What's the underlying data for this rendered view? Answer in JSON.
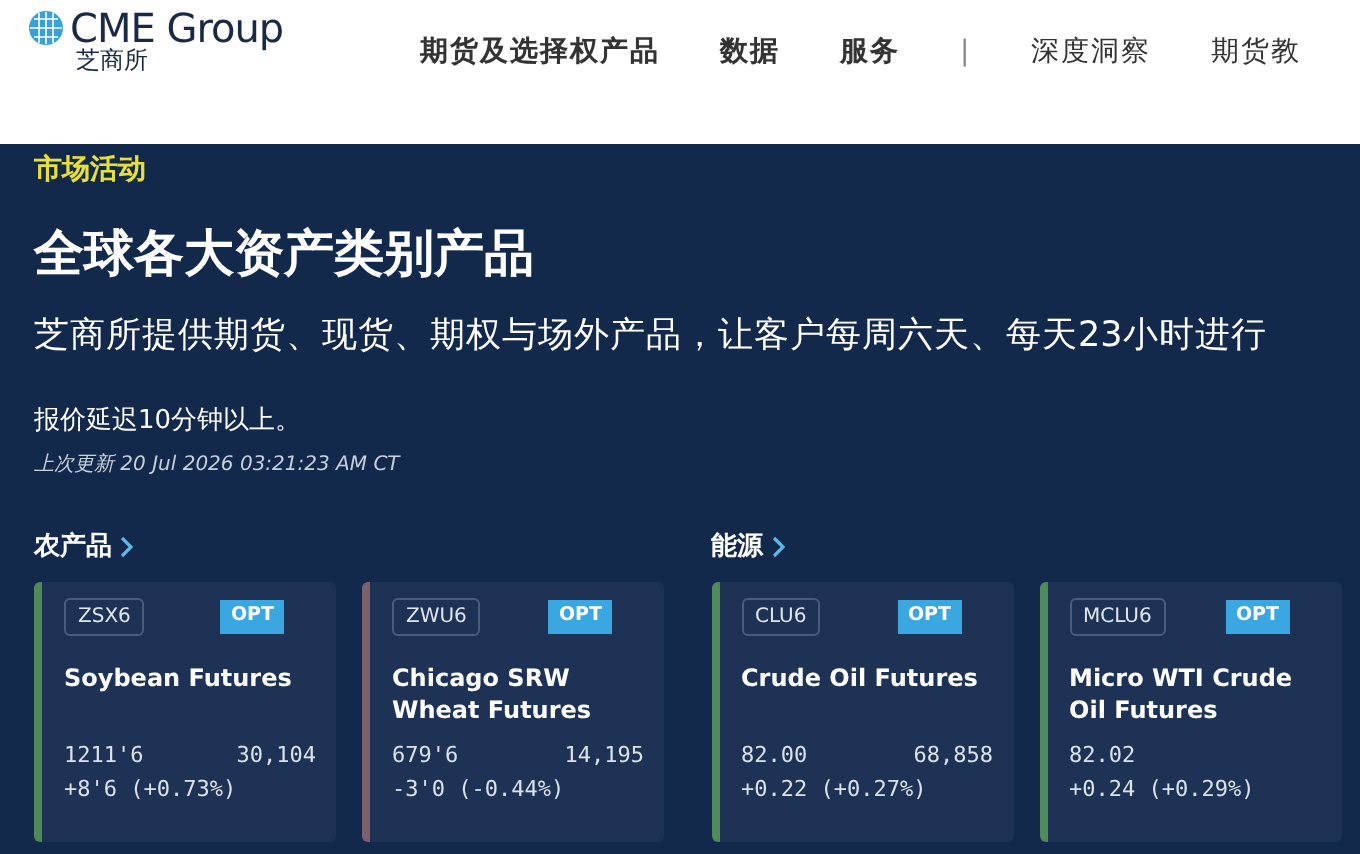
{
  "header": {
    "logo": {
      "name": "CME Group",
      "subtitle": "芝商所"
    },
    "nav": [
      {
        "label": "期货及选择权产品",
        "kind": "main"
      },
      {
        "label": "数据",
        "kind": "main"
      },
      {
        "label": "服务",
        "kind": "main"
      },
      {
        "label": "|",
        "kind": "divider"
      },
      {
        "label": "深度洞察",
        "kind": "light"
      },
      {
        "label": "期货教",
        "kind": "light"
      }
    ]
  },
  "hero": {
    "eyebrow": "市场活动",
    "title": "全球各大资产类别产品",
    "description": "芝商所提供期货、现货、期权与场外产品，让客户每周六天、每天23小时进行",
    "delay_note": "报价延迟10分钟以上。",
    "updated": "上次更新 20 Jul 2026 03:21:23 AM CT"
  },
  "groups": [
    {
      "title": "农产品",
      "cards": [
        {
          "code": "ZSX6",
          "tag": "OPT",
          "name": "Soybean Futures",
          "price": "1211'6",
          "volume": "30,104",
          "change": "+8'6 (+0.73%)",
          "color": "#4f8a5b"
        },
        {
          "code": "ZWU6",
          "tag": "OPT",
          "name": "Chicago SRW Wheat Futures",
          "price": "679'6",
          "volume": "14,195",
          "change": "-3'0 (-0.44%)",
          "color": "#7a6070"
        }
      ]
    },
    {
      "title": "能源",
      "cards": [
        {
          "code": "CLU6",
          "tag": "OPT",
          "name": "Crude Oil Futures",
          "price": "82.00",
          "volume": "68,858",
          "change": "+0.22 (+0.27%)",
          "color": "#4f8a5b"
        },
        {
          "code": "MCLU6",
          "tag": "OPT",
          "name": "Micro WTI Crude Oil Futures",
          "price": "82.02",
          "change": "+0.24 (+0.29%)",
          "color": "#4f8a5b"
        }
      ]
    }
  ]
}
